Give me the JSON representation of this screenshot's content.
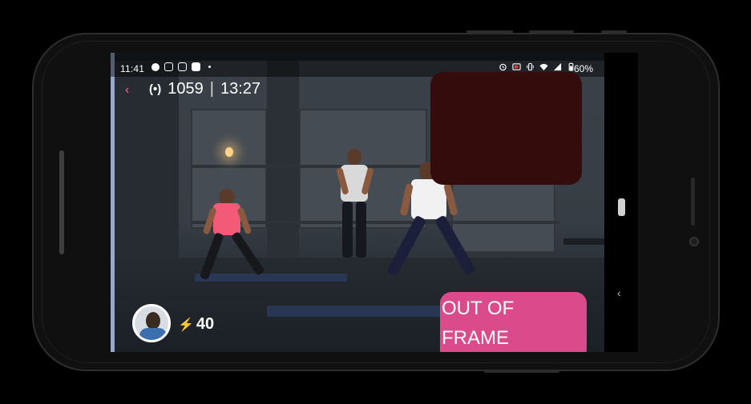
{
  "status_bar": {
    "time": "11:41",
    "battery": "60%",
    "left_icons": [
      "chat-bubble-icon",
      "instagram-icon",
      "instagram-icon",
      "photos-icon"
    ],
    "right_icons": [
      "alarm-icon",
      "cast-icon",
      "vibrate-icon",
      "wifi-icon",
      "signal-icon",
      "battery-icon"
    ]
  },
  "session": {
    "live_icon": "(•)",
    "viewers": "1059",
    "separator": "|",
    "elapsed": "13:27"
  },
  "user": {
    "energy_icon": "⚡",
    "energy_points": "40"
  },
  "badge": {
    "line1": "OUT OF",
    "line2": "FRAME"
  },
  "nav": {
    "back_glyph": "‹"
  },
  "colors": {
    "accent_pink": "#db4a8a",
    "video_placeholder": "#340c0c",
    "energy_bolt": "#ffcc00"
  }
}
